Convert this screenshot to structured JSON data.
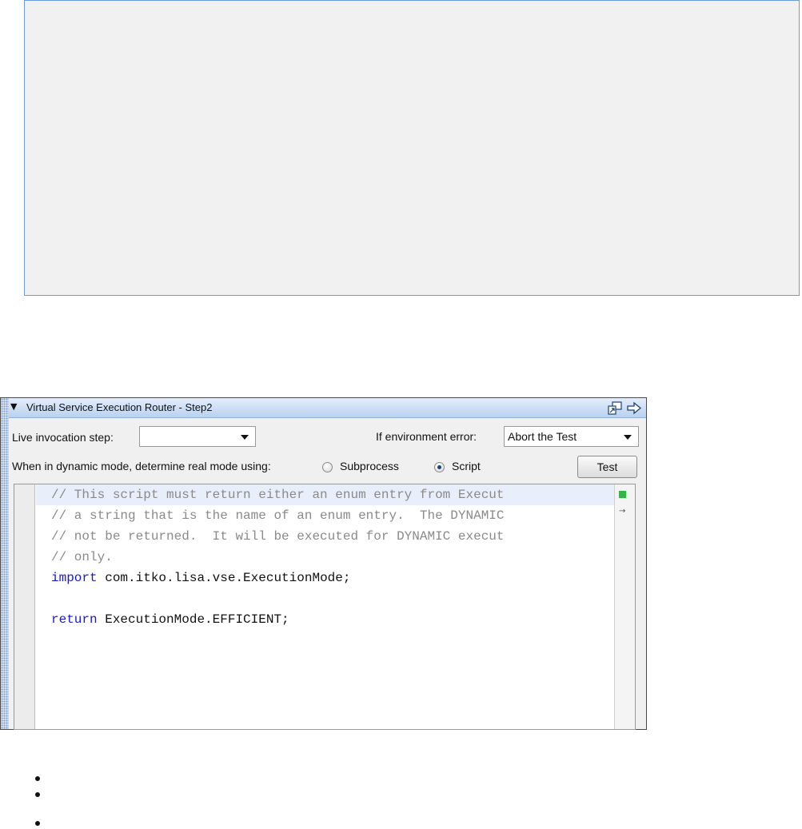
{
  "panel": {
    "title": "Virtual Service Execution Router - Step2",
    "live_invocation_label": "Live invocation step:",
    "live_invocation_value": "",
    "env_error_label": "If environment error:",
    "env_error_value": "Abort the Test",
    "dynamic_mode_label": "When in dynamic mode, determine real mode using:",
    "radio_subprocess_label": "Subprocess",
    "radio_script_label": "Script",
    "selected_radio": "Script",
    "test_button_label": "Test"
  },
  "editor": {
    "lines": [
      "// This script must return either an enum entry from Execut",
      "// a string that is the name of an enum entry.  The DYNAMIC",
      "// not be returned.  It will be executed for DYNAMIC execut",
      "// only.",
      "import com.itko.lisa.vse.ExecutionMode;",
      "",
      "return ExecutionMode.EFFICIENT;"
    ]
  },
  "colors": {
    "accent_border": "#6f9ad8",
    "titlebar": "#b9d1ef",
    "keyword": "#1919c8",
    "comment": "#8a8a8a",
    "status_ok": "#35b44a"
  },
  "icons": {
    "triangle": "collapse-triangle-icon",
    "restore": "restore-window-icon",
    "arrow": "dock-arrow-icon"
  }
}
